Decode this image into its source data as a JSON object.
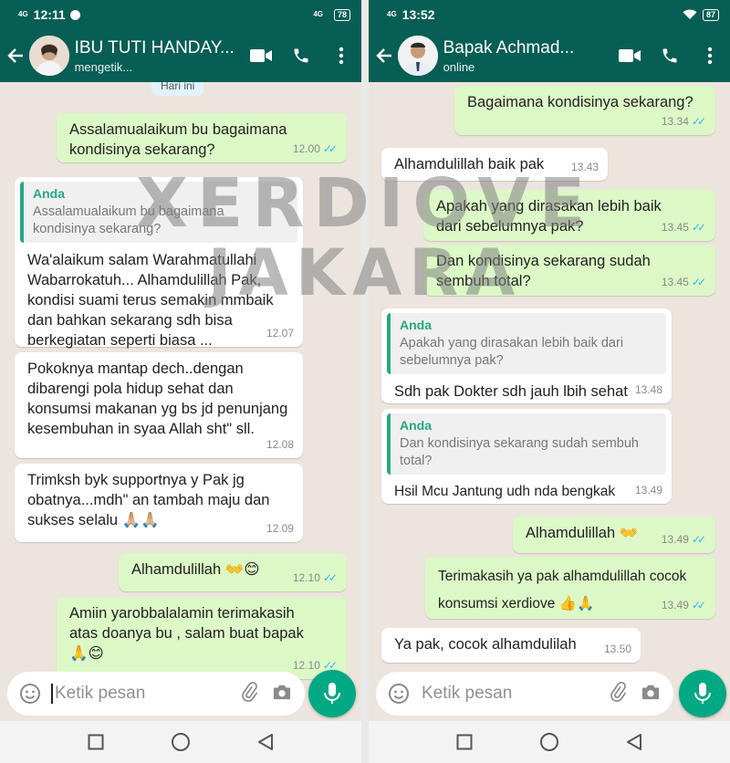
{
  "colors": {
    "header": "#075e54",
    "incoming": "#ffffff",
    "outgoing": "#dcf8c6",
    "read_ticks": "#34b7f1",
    "mic_button": "#00a884",
    "quote_accent": "#25a884"
  },
  "left": {
    "status": {
      "network": "4G",
      "time": "12:11",
      "network_right": "4G",
      "battery": "78"
    },
    "contact": {
      "name": "IBU TUTI HANDAY...",
      "subtitle": "mengetik..."
    },
    "day_chip": "Hari ini",
    "messages": [
      {
        "dir": "out",
        "text": "Assalamualaikum bu bagaimana kondisinya sekarang?",
        "time": "12.00"
      },
      {
        "dir": "in",
        "quote_author": "Anda",
        "quote_text": "Assalamualaikum bu bagaimana kondisinya sekarang?",
        "text": "Wa'alaikum salam Warahmatullahi Wabarrokatuh... Alhamdulillah Pak, kondisi suami terus semakin mmbaik dan bahkan sekarang sdh bisa berkegiatan seperti biasa ...",
        "time": "12.07"
      },
      {
        "dir": "in",
        "text": "Pokoknya mantap dech..dengan dibarengi pola hidup sehat dan konsumsi makanan yg bs jd penunjang kesembuhan in syaa Allah sht\" sll.",
        "time": "12.08"
      },
      {
        "dir": "in",
        "text": "Trimksh byk supportnya y Pak jg obatnya...mdh\" an tambah maju dan sukses selalu 🙏🏼🙏🏼",
        "time": "12.09"
      },
      {
        "dir": "out",
        "text": "Alhamdulillah 👐😊",
        "time": "12.10"
      },
      {
        "dir": "out",
        "text": "Amiin yarobbalalamin terimakasih atas doanya bu , salam buat bapak 🙏😊",
        "time": "12.10"
      }
    ],
    "composer_placeholder": "Ketik pesan"
  },
  "right": {
    "status": {
      "network": "4G",
      "time": "13:52",
      "battery": "87"
    },
    "contact": {
      "name": "Bapak Achmad...",
      "subtitle": "online"
    },
    "messages": [
      {
        "dir": "out",
        "text": "Bagaimana kondisinya sekarang?",
        "time": "13.34"
      },
      {
        "dir": "in",
        "text": "Alhamdulillah baik pak",
        "time": "13.43"
      },
      {
        "dir": "out",
        "text": "Apakah yang dirasakan lebih baik dari sebelumnya pak?",
        "time": "13.45"
      },
      {
        "dir": "out",
        "text": "Dan kondisinya sekarang sudah sembuh total?",
        "time": "13.45"
      },
      {
        "dir": "in",
        "quote_author": "Anda",
        "quote_text": "Apakah yang dirasakan lebih baik dari sebelumnya pak?",
        "text": "Sdh pak Dokter sdh jauh lbih sehat",
        "time": "13.48"
      },
      {
        "dir": "in",
        "quote_author": "Anda",
        "quote_text": "Dan kondisinya sekarang sudah sembuh total?",
        "text": "Hsil Mcu Jantung udh nda bengkak",
        "time": "13.49"
      },
      {
        "dir": "out",
        "text": "Alhamdulillah 👐",
        "time": "13.49"
      },
      {
        "dir": "out",
        "text": "Terimakasih ya pak alhamdulillah cocok konsumsi xerdiove 👍🙏",
        "time": "13.49"
      },
      {
        "dir": "in",
        "text": "Ya pak, cocok alhamdulilah",
        "time": "13.50"
      }
    ],
    "composer_placeholder": "Ketik pesan"
  },
  "watermark": {
    "line1": "XERDIOVE",
    "line2": "JAKARA"
  }
}
